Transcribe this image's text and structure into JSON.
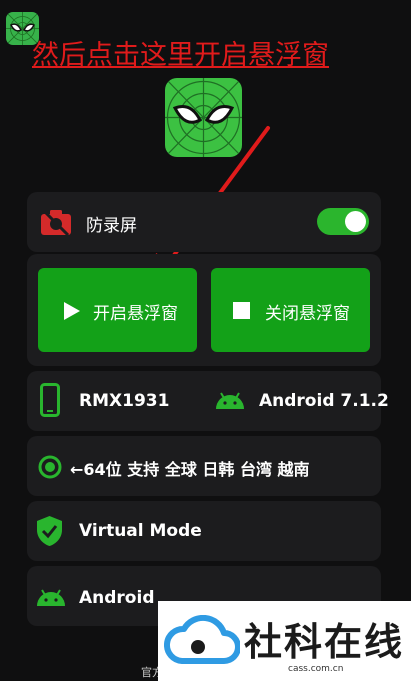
{
  "annotation": {
    "text": "然后点击这里开启悬浮窗"
  },
  "screen_protect": {
    "label": "防录屏",
    "enabled": true
  },
  "actions": {
    "start_label": "开启悬浮窗",
    "stop_label": "关闭悬浮窗"
  },
  "device": {
    "model": "RMX1931",
    "os": "Android 7.1.2"
  },
  "region": {
    "text": "←64位 支持 全球 日韩 台湾 越南"
  },
  "virtual": {
    "label": "Virtual Mode"
  },
  "android": {
    "label": "Android"
  },
  "footer": {
    "text": "官方"
  },
  "watermark": {
    "title": "社科在线",
    "url": "cass.com.cn"
  },
  "colors": {
    "accent_green": "#13a118",
    "toggle_green": "#2bb52d",
    "annotation_red": "#e01b1b",
    "icon_green": "#3cc142",
    "camera_red": "#d42a2a"
  },
  "icons": [
    "spider-mask-icon",
    "camera-off-icon",
    "play-icon",
    "stop-icon",
    "phone-icon",
    "android-icon",
    "radio-icon",
    "shield-check-icon",
    "cloud-logo-icon"
  ]
}
